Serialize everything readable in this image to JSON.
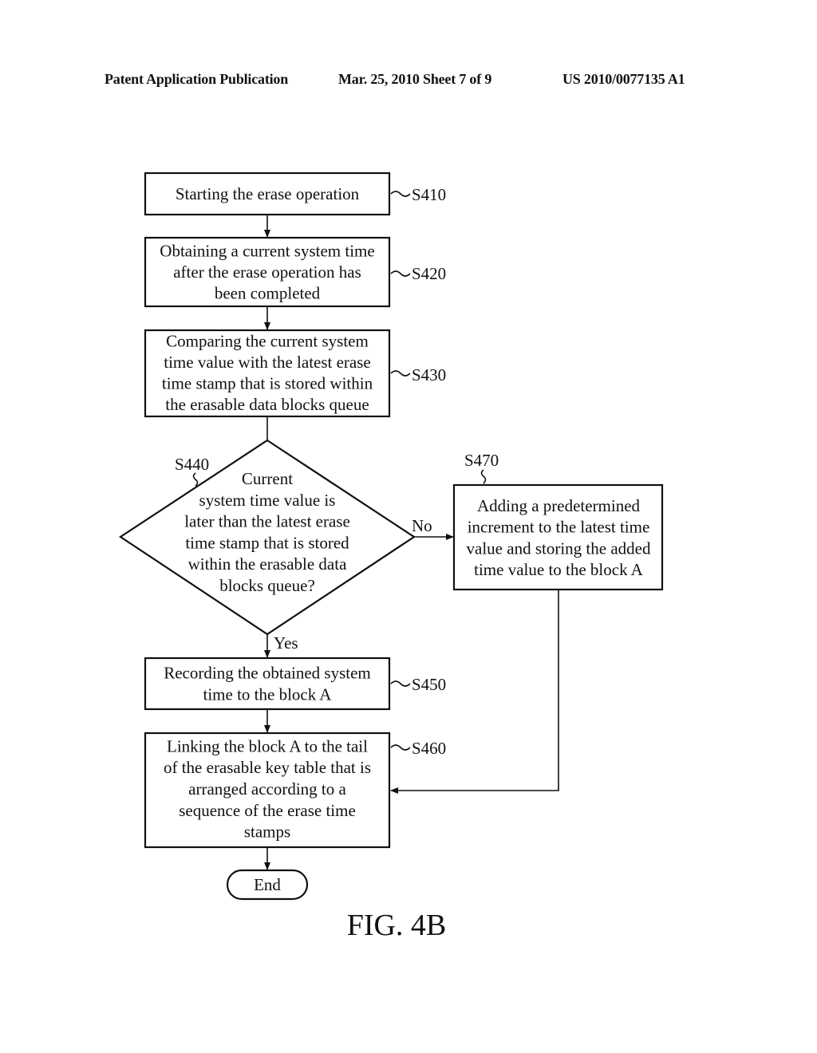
{
  "header": {
    "publication": "Patent Application Publication",
    "date_sheet": "Mar. 25, 2010  Sheet 7 of 9",
    "patent_number": "US 2010/0077135 A1"
  },
  "flowchart": {
    "steps": {
      "s410": {
        "id": "S410",
        "lines": [
          "Starting the erase operation"
        ]
      },
      "s420": {
        "id": "S420",
        "lines": [
          "Obtaining a current system time",
          "after the erase operation has",
          "been completed"
        ]
      },
      "s430": {
        "id": "S430",
        "lines": [
          "Comparing the current system",
          "time value with the latest erase",
          "time stamp that is stored within",
          "the erasable data blocks queue"
        ]
      },
      "s440": {
        "id": "S440",
        "lines": [
          "Current",
          "system time value is",
          "later than the latest erase",
          "time stamp that is stored",
          "within the erasable data",
          "blocks queue?"
        ]
      },
      "s450": {
        "id": "S450",
        "lines": [
          "Recording the obtained system",
          "time to the block A"
        ]
      },
      "s460": {
        "id": "S460",
        "lines": [
          "Linking the block A to the tail",
          "of the erasable key table that is",
          "arranged according to a",
          "sequence of the erase time",
          "stamps"
        ]
      },
      "s470": {
        "id": "S470",
        "lines": [
          "Adding a predetermined",
          "increment to the latest time",
          "value and storing the added",
          "time value to the block A"
        ]
      }
    },
    "branches": {
      "no": "No",
      "yes": "Yes"
    },
    "end_label": "End",
    "figure_label": "FIG.  4B"
  }
}
